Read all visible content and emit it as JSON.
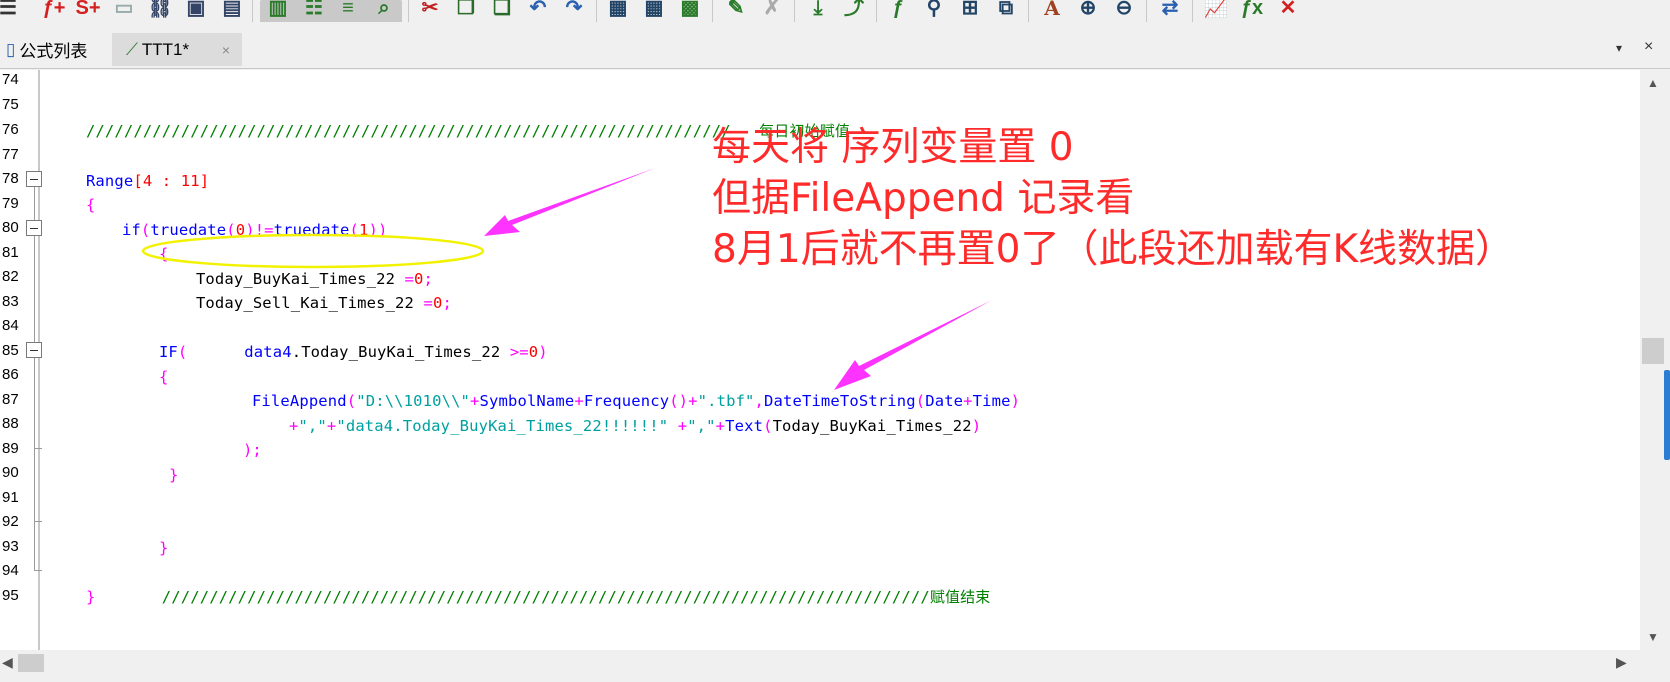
{
  "toolbar": {
    "icons": [
      "menu-icon",
      "new-function-icon",
      "new-strategy-icon",
      "open-icon",
      "link-icon",
      "save-icon",
      "save-all-icon",
      "layout-icon",
      "tree-icon",
      "view-icon",
      "find-in-files-icon",
      "cut-icon",
      "copy-icon",
      "paste-icon",
      "undo-icon",
      "redo-icon",
      "indent-icon",
      "outdent-icon",
      "bars-icon",
      "edit-icon",
      "clear-icon",
      "import-icon",
      "export-icon",
      "function-icon",
      "search-icon",
      "structure-icon",
      "preview-icon",
      "font-icon",
      "zoom-in-icon",
      "zoom-out-icon",
      "refresh-icon",
      "chart-icon",
      "fx-icon",
      "delete-icon"
    ]
  },
  "tabs": {
    "formula_list": "公式列表",
    "ttt1": "TTT1*",
    "close_glyph": "×",
    "dropdown_glyph": "▾",
    "close_all_glyph": "×"
  },
  "editor": {
    "line_numbers": [
      "74",
      "75",
      "76",
      "77",
      "78",
      "79",
      "80",
      "81",
      "82",
      "83",
      "84",
      "85",
      "86",
      "87",
      "88",
      "89",
      "90",
      "91",
      "92",
      "93",
      "94",
      "95"
    ],
    "line75_comment_slashes": "////////////////////////////////////////////////////////////////////",
    "line75_comment_text": "每日初始赋值",
    "line77_range": "Range",
    "line77_bracket_open": "[",
    "line77_nums": "4 : 11",
    "line77_bracket_close": "]",
    "brace_open": "{",
    "brace_close": "}",
    "line79_if": "if",
    "line79_fn": "truedate",
    "line79_zero": "0",
    "line79_one": "1",
    "line81_var": "Today_BuyKai_Times_22",
    "line82_var": "Today_Sell_Kai_Times_22",
    "assign_zero_op": "=",
    "assign_zero_num": "0",
    "semicolon": ";",
    "line84_if": "IF",
    "line84_data": "data4",
    "line84_member": "Today_BuyKai_Times_22",
    "line84_op": ">=",
    "line84_num": "0",
    "line86_fn": "FileAppend",
    "line86_str1": "\"D:\\\\1010\\\\\"",
    "line86_sym": "SymbolName",
    "line86_freq": "Frequency",
    "line86_str2": "\".tbf\"",
    "line86_dts": "DateTimeToString",
    "line86_date": "Date",
    "line86_time": "Time",
    "line87_str1": "\",\"",
    "line87_str2": "\"data4.Today_BuyKai_Times_22!!!!!!\"",
    "line87_str3": "\",\"",
    "line87_text": "Text",
    "line87_var": "Today_BuyKai_Times_22",
    "line88_end": ");",
    "line94_slashes": "/////////////////////////////////////////////////////////////////////////////////",
    "line94_text": "赋值结束"
  },
  "annotation": {
    "line1": "每天将 序列变量置 0",
    "line2": "但据FileAppend 记录看",
    "line3": "8月1后就不再置0了（此段还加载有K线数据）"
  },
  "colors": {
    "keyword": "#0000ff",
    "operator": "#ff00ff",
    "number": "#ff0000",
    "string": "#00a0a0",
    "comment": "#008000",
    "annotation": "#ff2a2a",
    "ellipse": "#f2f200",
    "arrow": "#ff33ff"
  }
}
